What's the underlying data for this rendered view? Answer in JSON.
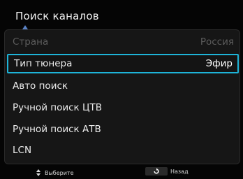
{
  "header": {
    "title": "Поиск каналов"
  },
  "menu": {
    "items": [
      {
        "label": "Страна",
        "value": "Россия",
        "state": "disabled"
      },
      {
        "label": "Тип тюнера",
        "value": "Эфир",
        "state": "selected"
      },
      {
        "label": "Авто поиск",
        "value": "",
        "state": "normal"
      },
      {
        "label": "Ручной поиск ЦТВ",
        "value": "",
        "state": "normal"
      },
      {
        "label": "Ручной поиск АТВ",
        "value": "",
        "state": "normal"
      },
      {
        "label": "LCN",
        "value": "",
        "state": "normal"
      }
    ]
  },
  "footer": {
    "select_hint": "Выберите",
    "back_hint": "Назад",
    "select_icon": "up-down-arrows-icon",
    "back_icon": "back-return-icon"
  },
  "colors": {
    "background": "#050505",
    "panel": "#161616",
    "selection_border": "#1eb4d8",
    "disabled_text": "#5c5c5c",
    "accent_notch": "#5a82c4"
  }
}
